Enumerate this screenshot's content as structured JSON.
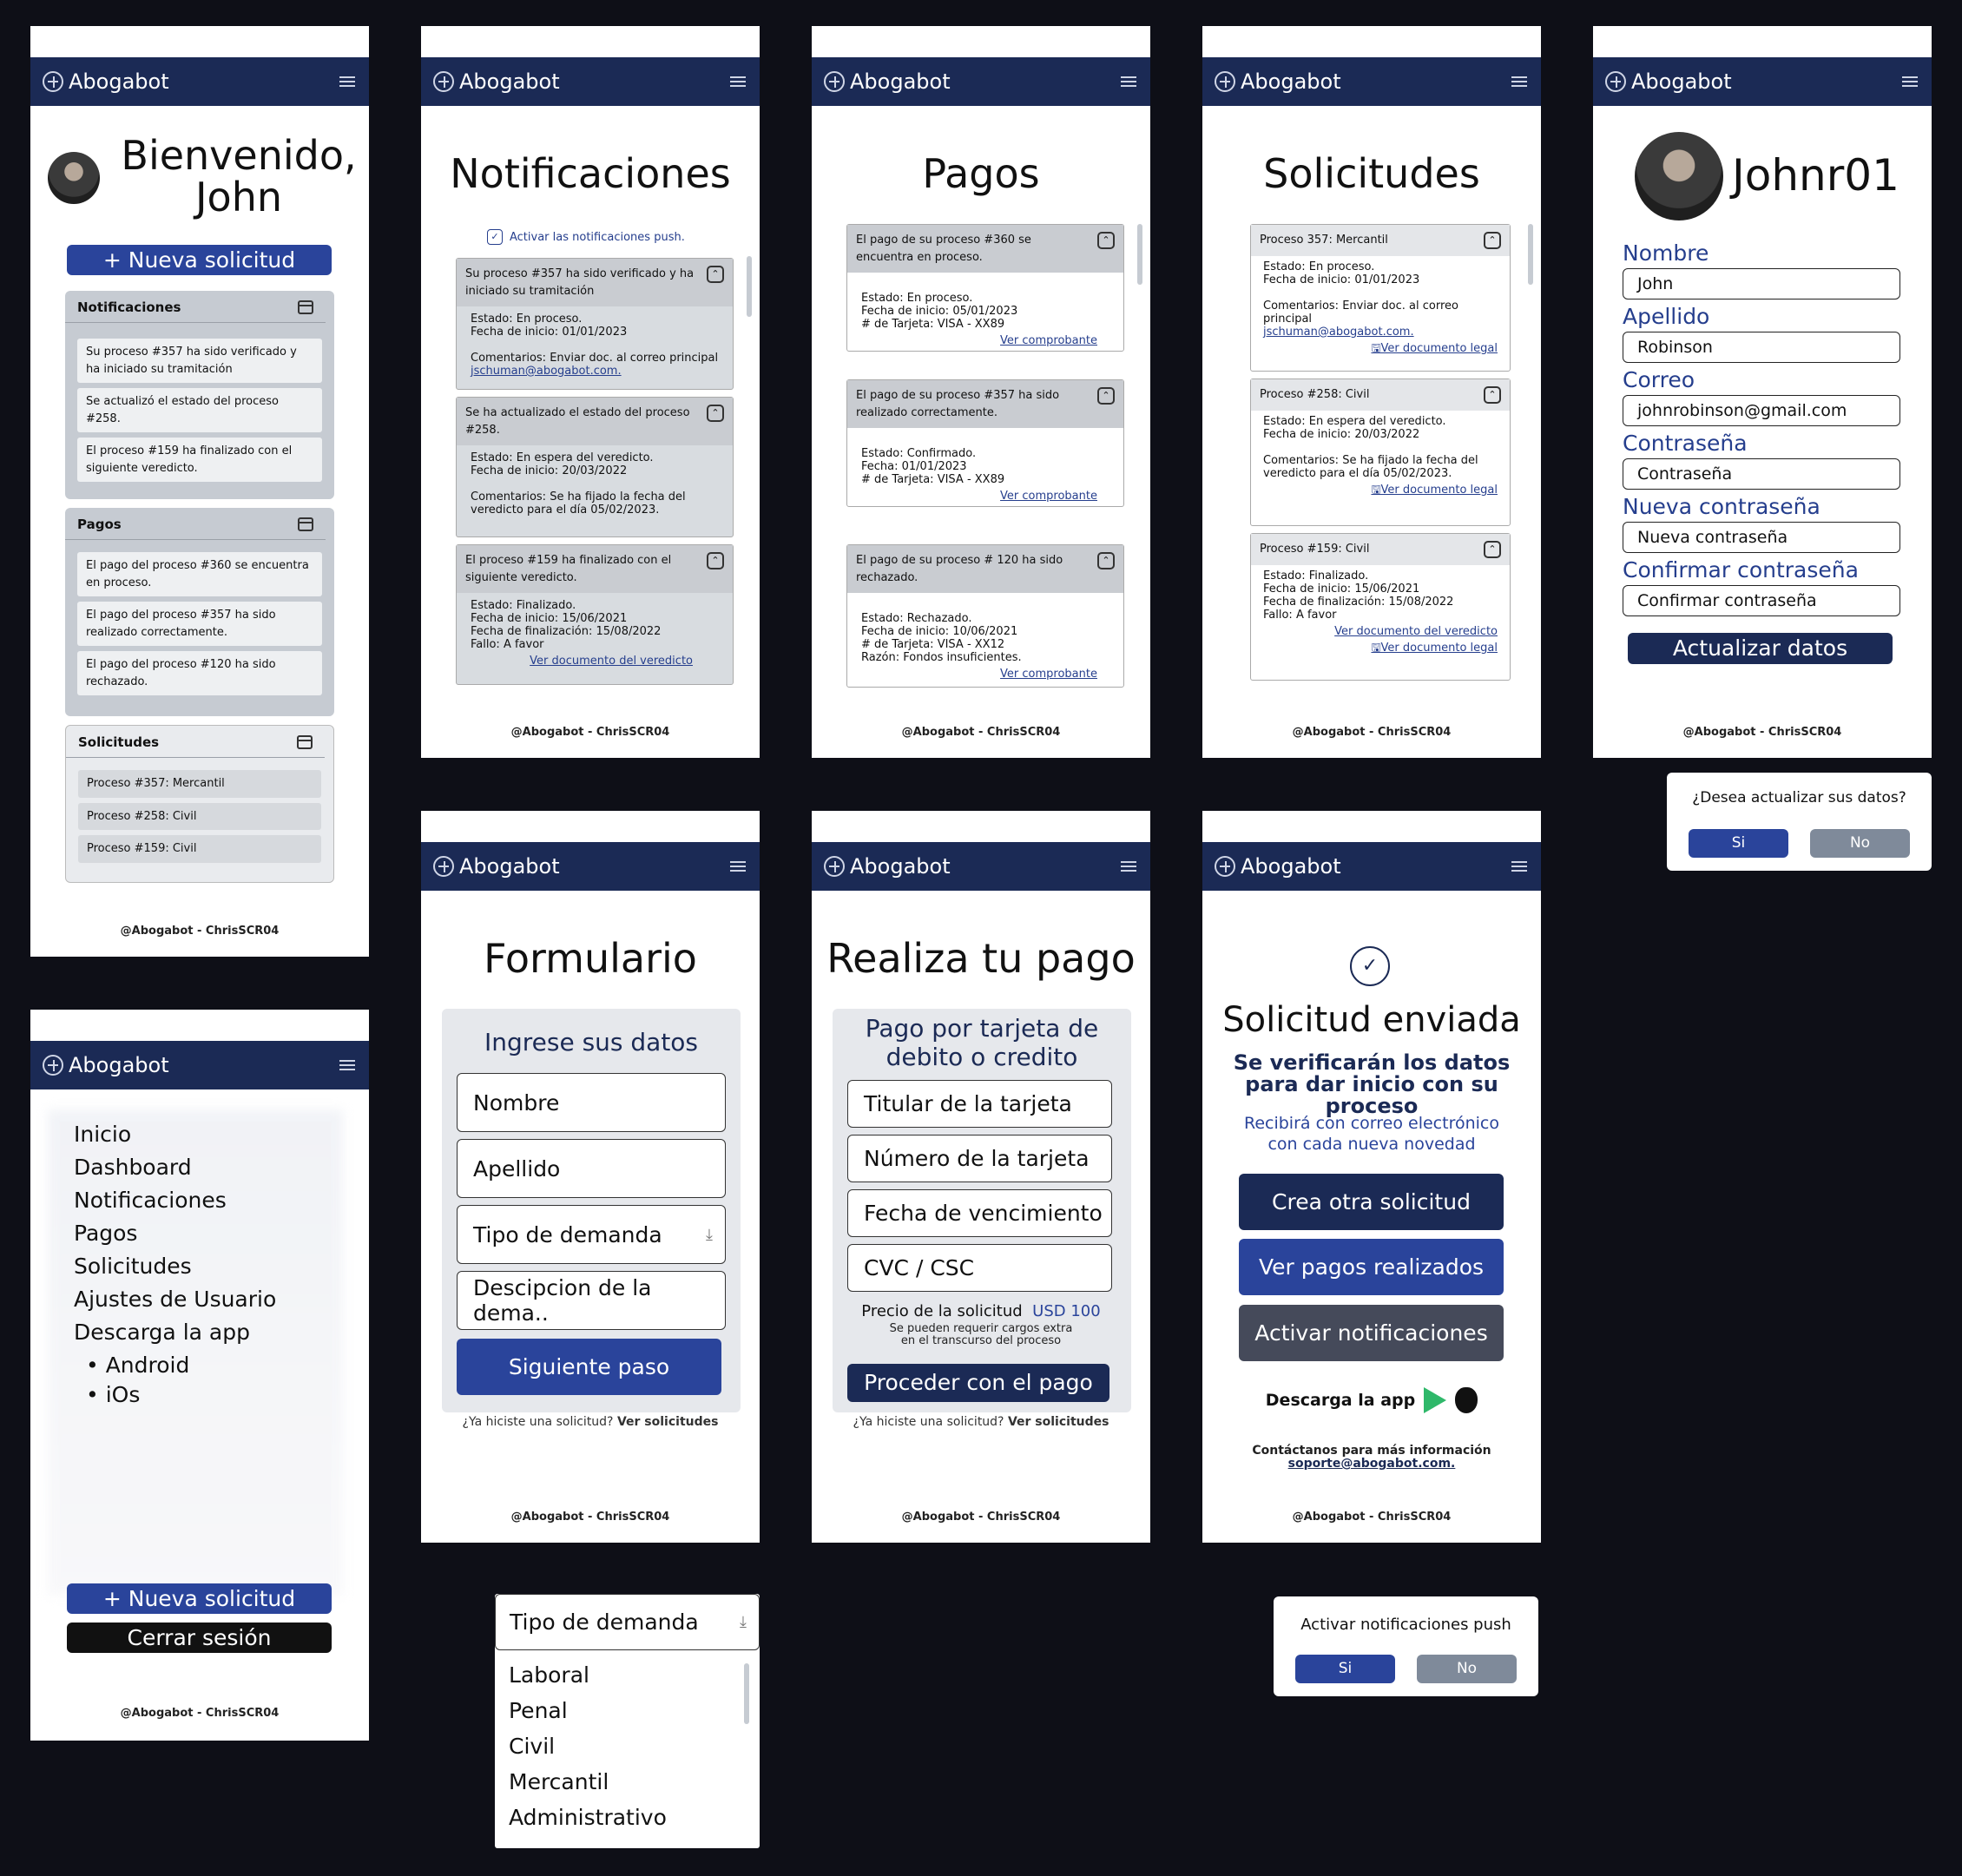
{
  "brand": "Abogabot",
  "footer": "@Abogabot -  ChrisSCR04",
  "home": {
    "title": "Bienvenido, John",
    "new_request": "+ Nueva solicitud",
    "notifications": {
      "title": "Notificaciones",
      "items": [
        "Su proceso #357 ha sido verificado y ha iniciado su tramitación",
        "Se actualizó el estado del proceso #258.",
        "El proceso #159 ha finalizado con el siguiente veredicto."
      ]
    },
    "payments": {
      "title": "Pagos",
      "items": [
        "El pago del proceso #360 se encuentra en proceso.",
        "El pago del proceso #357 ha sido realizado correctamente.",
        "El pago del proceso #120 ha sido rechazado."
      ]
    },
    "requests": {
      "title": "Solicitudes",
      "items": [
        "Proceso #357: Mercantil",
        "Proceso #258: Civil",
        "Proceso #159: Civil"
      ]
    }
  },
  "notif_page": {
    "title": "Notificaciones",
    "push_toggle": "Activar las notificaciones push.",
    "panels": [
      {
        "head": "Su proceso #357 ha sido verificado y ha iniciado su tramitación",
        "l1": "Estado: En proceso.",
        "l2": "Fecha de inicio: 01/01/2023",
        "l3": "Comentarios: Enviar doc. al correo principal",
        "email": "jschuman@abogabot.com."
      },
      {
        "head": "Se ha actualizado el estado del proceso #258.",
        "l1": "Estado: En espera del veredicto.",
        "l2": "Fecha de inicio: 20/03/2022",
        "l3": "Comentarios: Se ha fijado la fecha del veredicto para el día 05/02/2023."
      },
      {
        "head": "El proceso #159 ha finalizado con el siguiente veredicto.",
        "l1": "Estado: Finalizado.",
        "l2": "Fecha de inicio: 15/06/2021",
        "l3": "Fecha de finalización: 15/08/2022",
        "l4": "Fallo: A favor",
        "link": "Ver documento del veredicto"
      }
    ]
  },
  "pay_page": {
    "title": "Pagos",
    "panels": [
      {
        "head": "El pago de su proceso #360 se encuentra en proceso.",
        "l1": "Estado: En proceso.",
        "l2": "Fecha de inicio: 05/01/2023",
        "l3": "# de Tarjeta: VISA - XX89",
        "link": "Ver comprobante"
      },
      {
        "head": "El pago de su proceso #357 ha sido realizado correctamente.",
        "l1": "Estado: Confirmado.",
        "l2": "Fecha: 01/01/2023",
        "l3": "# de Tarjeta: VISA - XX89",
        "link": "Ver comprobante"
      },
      {
        "head": "El pago de su proceso # 120 ha sido rechazado.",
        "l1": "Estado: Rechazado.",
        "l2": "Fecha de inicio: 10/06/2021",
        "l3": "# de Tarjeta: VISA - XX12",
        "l4": "Razón: Fondos insuficientes.",
        "link": "Ver comprobante"
      }
    ]
  },
  "req_page": {
    "title": "Solicitudes",
    "panels": [
      {
        "head": "Proceso 357: Mercantil",
        "l1": "Estado: En proceso.",
        "l2": "Fecha de inicio: 01/01/2023",
        "l3": "Comentarios: Enviar doc. al correo principal",
        "email": "jschuman@abogabot.com.",
        "link": "Ver documento legal"
      },
      {
        "head": "Proceso #258: Civil",
        "l1": "Estado: En espera del veredicto.",
        "l2": "Fecha de inicio: 20/03/2022",
        "l3": "Comentarios: Se ha fijado la fecha del veredicto para el día 05/02/2023.",
        "link": "Ver documento legal"
      },
      {
        "head": "Proceso #159: Civil",
        "l1": "Estado: Finalizado.",
        "l2": "Fecha de inicio: 15/06/2021",
        "l3": "Fecha de finalización: 15/08/2022",
        "l4": "Fallo: A favor",
        "link2": "Ver documento del veredicto",
        "link": "Ver documento legal"
      }
    ]
  },
  "profile": {
    "username": "Johnr01",
    "fields": [
      {
        "label": "Nombre",
        "value": "John"
      },
      {
        "label": "Apellido",
        "value": "Robinson"
      },
      {
        "label": "Correo",
        "value": "johnrobinson@gmail.com"
      },
      {
        "label": "Contraseña",
        "value": "Contraseña"
      },
      {
        "label": "Nueva contraseña",
        "value": "Nueva contraseña"
      },
      {
        "label": "Confirmar contraseña",
        "value": "Confirmar contraseña"
      }
    ],
    "update": "Actualizar datos",
    "confirm_q": "¿Desea actualizar sus datos?",
    "yes": "Si",
    "no": "No"
  },
  "menu": {
    "items": [
      "Inicio",
      "Dashboard",
      "Notificaciones",
      "Pagos",
      "Solicitudes",
      "Ajustes de Usuario",
      "Descarga la app"
    ],
    "sub": [
      "Android",
      "iOs"
    ],
    "new_request": "+ Nueva solicitud",
    "logout": "Cerrar sesión"
  },
  "form": {
    "title": "Formulario",
    "subtitle": "Ingrese sus datos",
    "f1": "Nombre",
    "f2": "Apellido",
    "f3": "Tipo de demanda",
    "f4": "Descipcion de la dema..",
    "next": "Siguiente paso",
    "q": "¿Ya hiciste una solicitud?",
    "q_link": "Ver solicitudes",
    "dropdown": {
      "title": "Tipo de demanda",
      "options": [
        "Laboral",
        "Penal",
        "Civil",
        "Mercantil",
        "Administrativo"
      ]
    }
  },
  "payment_form": {
    "title": "Realiza tu pago",
    "subtitle": "Pago por tarjeta de debito o credito",
    "f1": "Titular de la tarjeta",
    "f2": "Número de la tarjeta",
    "f3": "Fecha de vencimiento",
    "f4": "CVC / CSC",
    "price_label": "Precio de la solicitud",
    "price": "USD 100",
    "note1": "Se pueden requerir cargos extra",
    "note2": "en el transcurso del proceso",
    "proceed": "Proceder con el pago",
    "q": "¿Ya hiciste una solicitud?",
    "q_link": "Ver solicitudes"
  },
  "sent": {
    "title": "Solicitud enviada",
    "sub1": "Se verificarán los datos para dar inicio con su proceso",
    "sub2": "Recibirá con correo electrónico con cada nueva novedad",
    "b1": "Crea otra solicitud",
    "b2": "Ver pagos realizados",
    "b3": "Activar notificaciones",
    "download": "Descarga la app",
    "contact": "Contáctanos para más información",
    "email": "soporte@abogabot.com.",
    "push_q": "Activar notificaciones push",
    "yes": "Si",
    "no": "No"
  },
  "colors": {
    "navy": "#1b2a55",
    "blue": "#2a449b",
    "gray": "#c6cbd2",
    "dark": "#111111"
  }
}
